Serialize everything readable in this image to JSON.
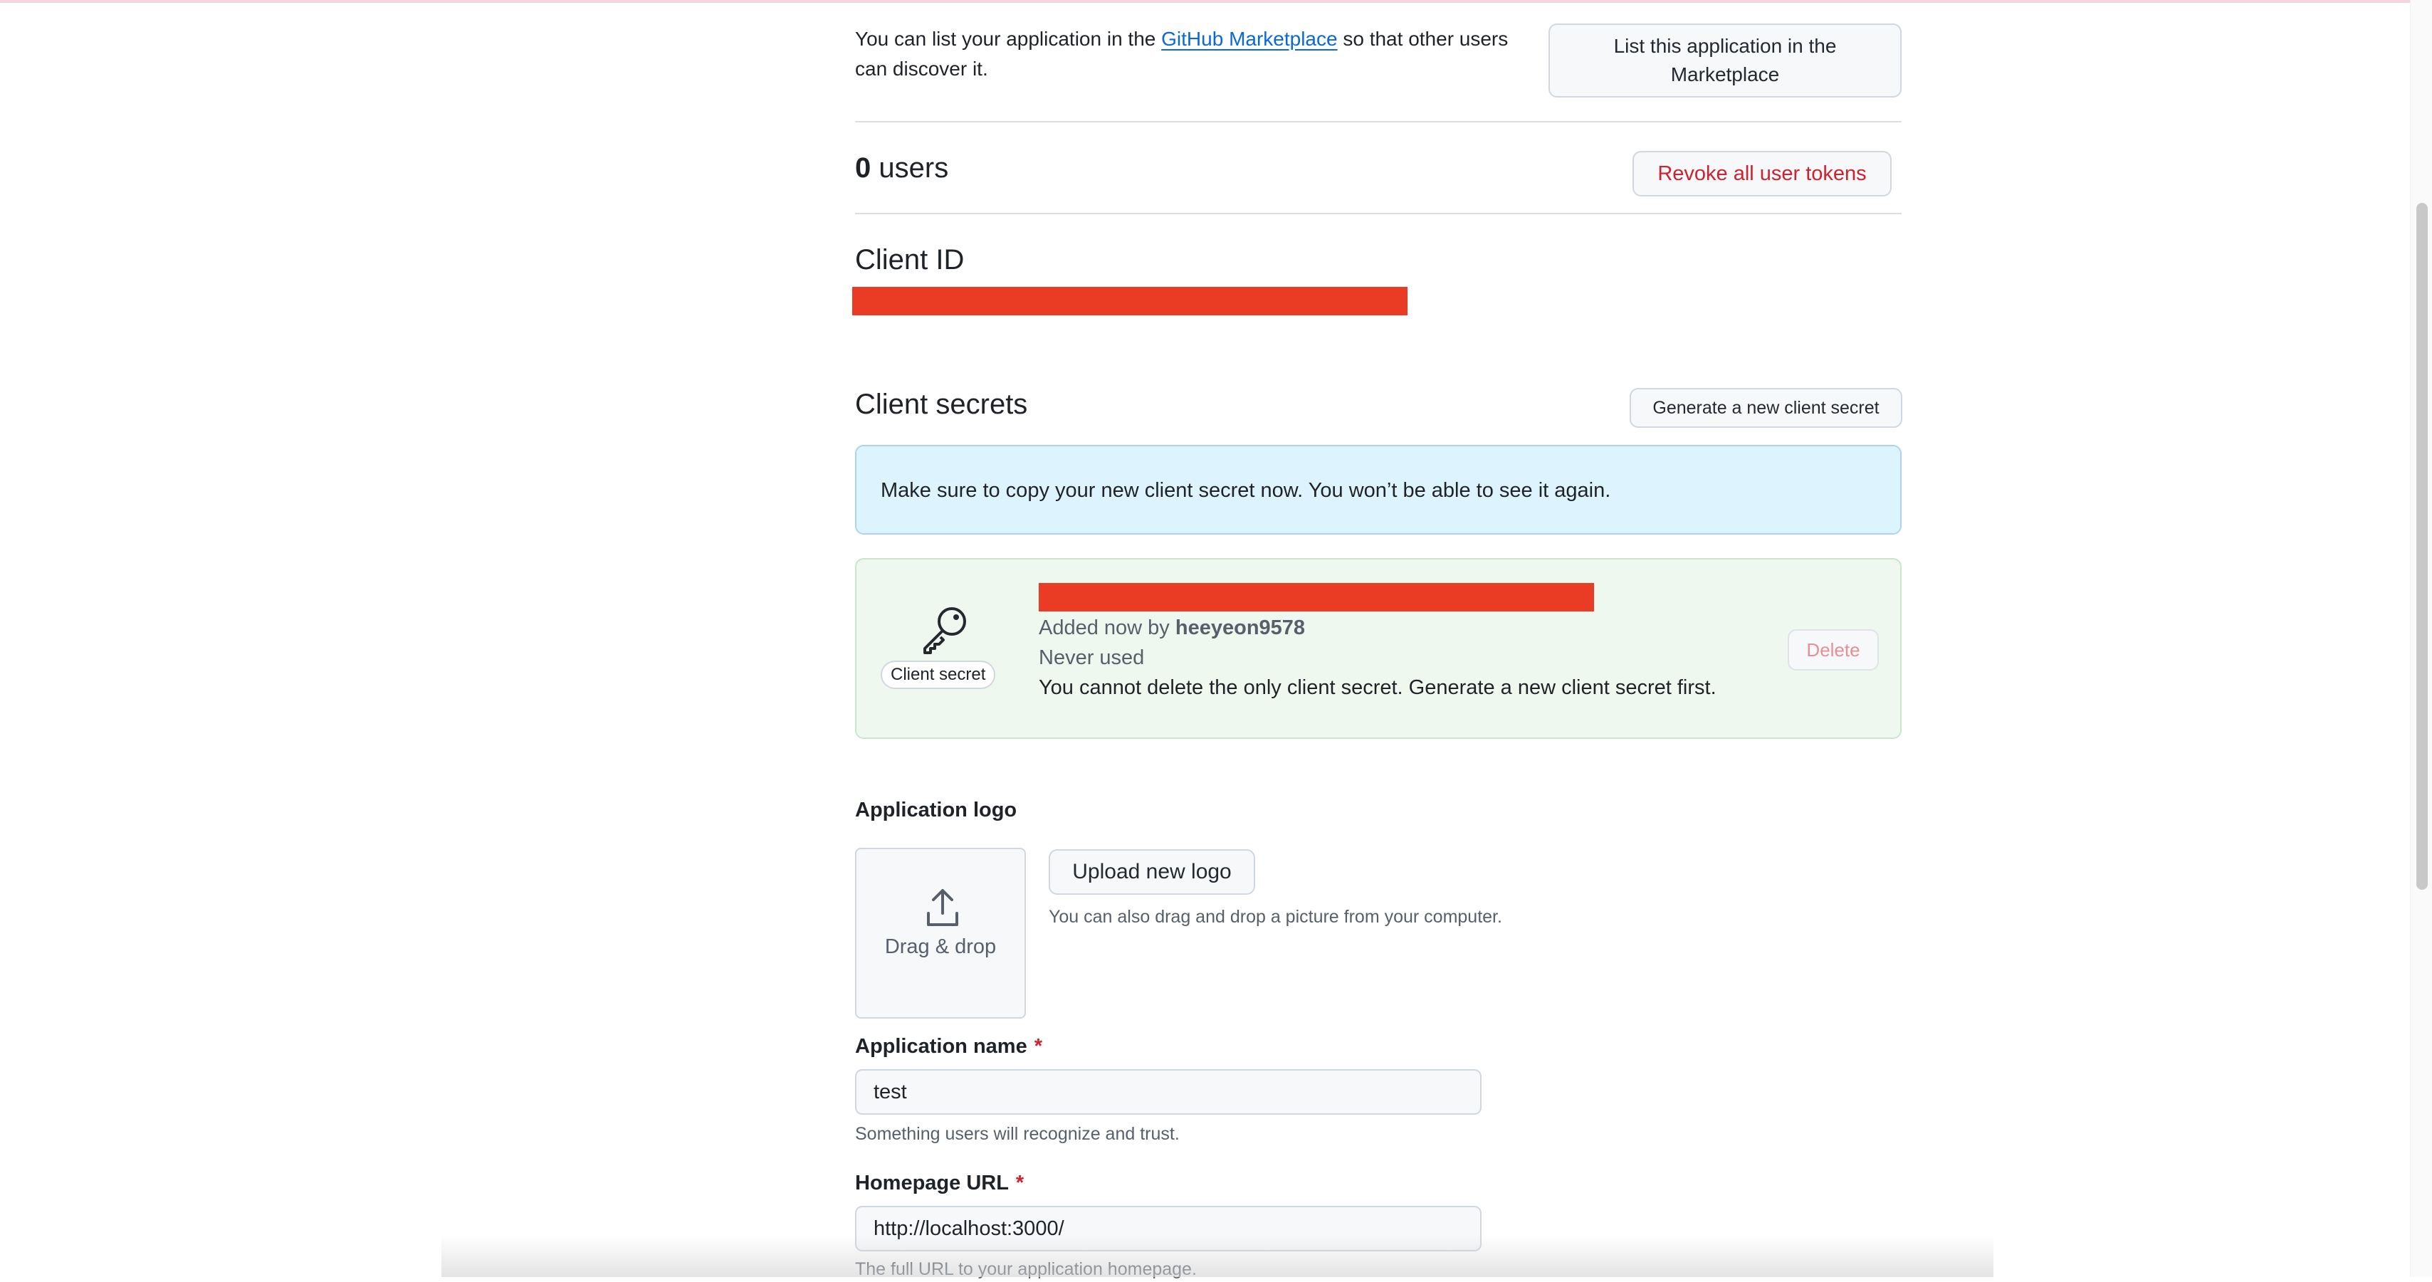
{
  "marketplace": {
    "text_before": "You can list your application in the ",
    "link": "GitHub Marketplace",
    "text_after": " so that other users can discover it.",
    "button": "List this application in the Marketplace"
  },
  "users": {
    "count": "0",
    "label": "users",
    "revoke_button": "Revoke all user tokens"
  },
  "client_id": {
    "title": "Client ID"
  },
  "client_secrets": {
    "title": "Client secrets",
    "generate_button": "Generate a new client secret",
    "flash_message": "Make sure to copy your new client secret now. You won’t be able to see it again.",
    "secret": {
      "badge": "Client secret",
      "added_prefix": "Added now by",
      "added_by": "heeyeon9578",
      "usage": "Never used",
      "note": "You cannot delete the only client secret. Generate a new client secret first.",
      "delete_button": "Delete"
    }
  },
  "app_logo": {
    "label": "Application logo",
    "dropzone_label": "Drag & drop",
    "upload_button": "Upload new logo",
    "hint": "You can also drag and drop a picture from your computer."
  },
  "app_name": {
    "label": "Application name",
    "required_marker": "*",
    "value": "test",
    "hint": "Something users will recognize and trust."
  },
  "homepage_url": {
    "label": "Homepage URL",
    "required_marker": "*",
    "value": "http://localhost:3000/",
    "hint": "The full URL to your application homepage."
  },
  "icons": [
    "key-icon",
    "upload-icon"
  ],
  "colors": {
    "link": "#0969da",
    "danger": "#cf222e",
    "redaction": "#ea3c24",
    "info_bg": "#ddf4ff",
    "success_bg": "#eff8ef"
  }
}
